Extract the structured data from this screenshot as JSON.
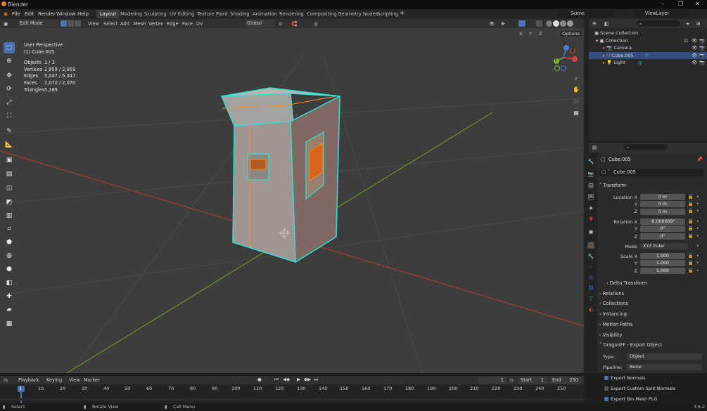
{
  "app": {
    "title": "Blender",
    "version": "3.6.2"
  },
  "menu": [
    "File",
    "Edit",
    "Render",
    "Window",
    "Help"
  ],
  "workspaces": [
    "Layout",
    "Modeling",
    "Sculpting",
    "UV Editing",
    "Texture Paint",
    "Shading",
    "Animation",
    "Rendering",
    "Compositing",
    "Geometry Nodes",
    "Scripting"
  ],
  "active_workspace": "Layout",
  "scene": {
    "name": "Scene",
    "view_layer": "ViewLayer"
  },
  "viewport_header": {
    "mode": "Edit Mode",
    "menus": [
      "View",
      "Select",
      "Add",
      "Mesh",
      "Vertex",
      "Edge",
      "Face",
      "UV"
    ],
    "transform_orientation": "Global",
    "options_label": "Options",
    "axes": [
      "X",
      "Y",
      "Z"
    ]
  },
  "overlay": {
    "view_name": "User Perspective",
    "object_name": "(1) Cube.005",
    "stats": [
      {
        "label": "Objects",
        "value": "1 / 3"
      },
      {
        "label": "Vertices",
        "value": "2,959 / 2,959"
      },
      {
        "label": "Edges",
        "value": "5,047 / 5,047"
      },
      {
        "label": "Faces",
        "value": "2,070 / 2,070"
      },
      {
        "label": "Triangles",
        "value": "5,189"
      }
    ]
  },
  "gizmo": {
    "x": "X",
    "y": "Y",
    "z": "Z"
  },
  "outliner": {
    "items": [
      {
        "name": "Scene Collection",
        "indent": 0,
        "selected": false
      },
      {
        "name": "Collection",
        "indent": 1,
        "selected": false
      },
      {
        "name": "Camera",
        "indent": 2,
        "selected": false
      },
      {
        "name": "Cube.005",
        "indent": 2,
        "selected": true
      },
      {
        "name": "Light",
        "indent": 2,
        "selected": false
      }
    ]
  },
  "properties": {
    "object_name": "Cube.005",
    "data_name": "Cube.005",
    "transform_label": "Transform",
    "location": {
      "label": "Location X",
      "x": "0 m",
      "y": "0 m",
      "z": "0 m"
    },
    "rotation": {
      "label": "Rotation X",
      "x": "-0.000009°",
      "y": "0°",
      "z": "0°"
    },
    "mode": {
      "label": "Mode",
      "value": "XYZ Euler"
    },
    "scale": {
      "label": "Scale X",
      "x": "1.000",
      "y": "1.000",
      "z": "1.000"
    },
    "axis_y": "Y",
    "axis_z": "Z",
    "sections": [
      "Delta Transform",
      "Relations",
      "Collections",
      "Instancing",
      "Motion Paths",
      "Visibility"
    ],
    "export_panel": {
      "title": "DragonFF - Export Object",
      "type_label": "Type:",
      "type_value": "Object",
      "pipeline_label": "Pipeline:",
      "pipeline_value": "None",
      "options": [
        {
          "label": "Export Normals",
          "checked": true
        },
        {
          "label": "Export Custom Split Normals",
          "checked": false
        },
        {
          "label": "Export Bin Mesh PLG",
          "checked": true
        }
      ]
    }
  },
  "timeline": {
    "menus": [
      "Playback",
      "Keying",
      "View",
      "Marker"
    ],
    "current_frame": "1",
    "start_label": "Start",
    "start": "1",
    "end_label": "End",
    "end": "250",
    "ticks": [
      "1",
      "10",
      "20",
      "30",
      "40",
      "50",
      "60",
      "70",
      "80",
      "90",
      "100",
      "110",
      "120",
      "130",
      "140",
      "150",
      "160",
      "170",
      "180",
      "190",
      "200",
      "210",
      "220",
      "230",
      "240",
      "250"
    ]
  },
  "status": {
    "select": "Select",
    "rotate": "Rotate View",
    "menu": "Call Menu"
  },
  "colors": {
    "accent": "#4772b3",
    "selection_edge": "#ff8c1a",
    "selected_face_outline": "#33e0d6",
    "axis_x": "#d9403a",
    "axis_y": "#7fb32a",
    "axis_z": "#3b7ddd"
  }
}
